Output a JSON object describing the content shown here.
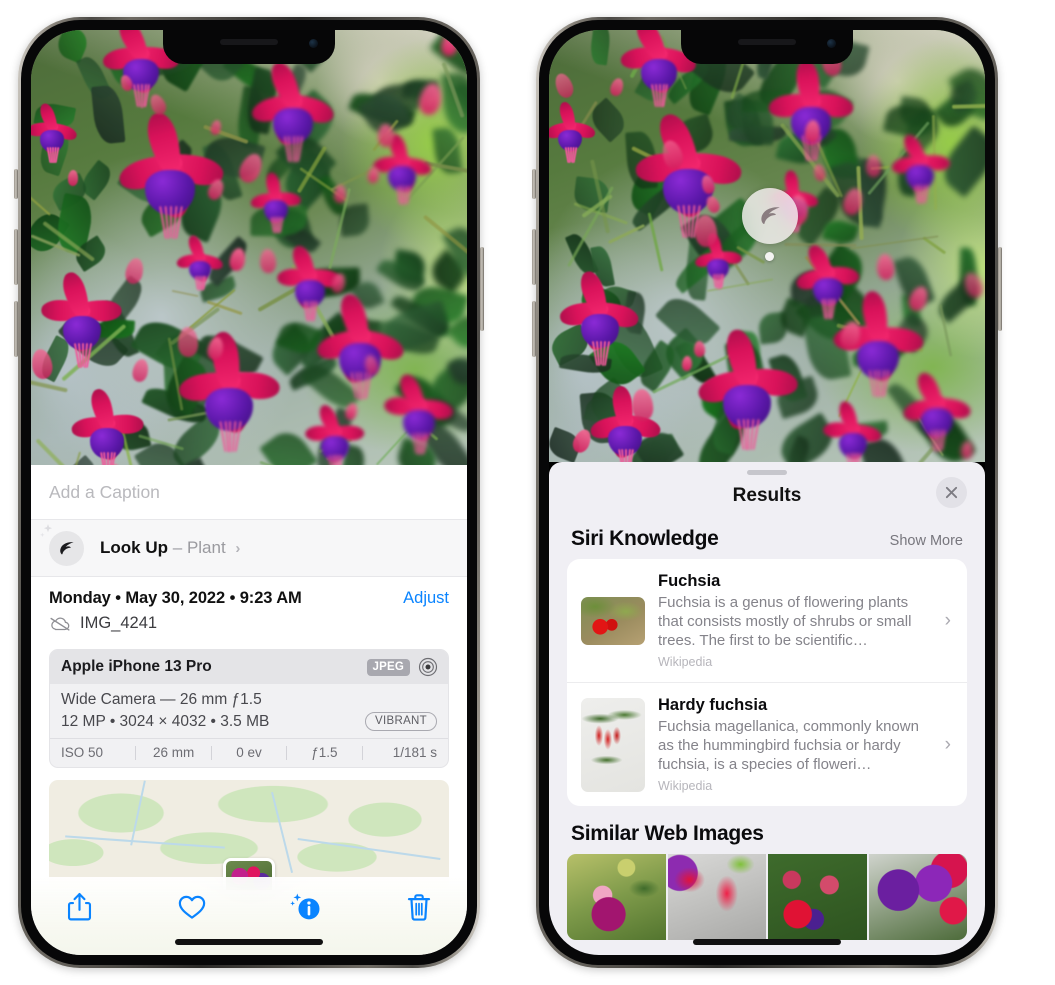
{
  "left_phone": {
    "caption_field": {
      "placeholder": "Add a Caption",
      "value": ""
    },
    "look_up": {
      "label": "Look Up",
      "dash": "–",
      "subject": "Plant",
      "chevron": "›",
      "icon": "leaf-icon"
    },
    "metadata": {
      "date_line": "Monday • May 30, 2022 • 9:23 AM",
      "adjust_label": "Adjust",
      "filename": "IMG_4241",
      "cloud_icon": "icloud-slash-icon"
    },
    "exif": {
      "device": "Apple iPhone 13 Pro",
      "format_tag": "JPEG",
      "raw_icon": "raw-target-icon",
      "lens": "Wide Camera — 26 mm ƒ1.5",
      "size": "12 MP • 3024 × 4032 • 3.5 MB",
      "style_tag": "VIBRANT",
      "stats": [
        "ISO 50",
        "26 mm",
        "0 ev",
        "ƒ1.5",
        "1/181 s"
      ]
    },
    "map": {
      "label": "photo-location-map"
    },
    "toolbar": [
      {
        "name": "share-button",
        "icon": "share-icon"
      },
      {
        "name": "favorite-button",
        "icon": "heart-icon"
      },
      {
        "name": "info-button",
        "icon": "info-sparkle-icon"
      },
      {
        "name": "delete-button",
        "icon": "trash-icon"
      }
    ]
  },
  "right_phone": {
    "badge": {
      "icon": "leaf-icon",
      "name": "visual-lookup-badge"
    },
    "sheet": {
      "title": "Results",
      "close_icon": "close-icon",
      "sections": [
        {
          "title": "Siri Knowledge",
          "action": "Show More",
          "items": [
            {
              "title": "Fuchsia",
              "description": "Fuchsia is a genus of flowering plants that consists mostly of shrubs or small trees. The first to be scientific…",
              "source": "Wikipedia",
              "chevron": "›"
            },
            {
              "title": "Hardy fuchsia",
              "description": "Fuchsia magellanica, commonly known as the hummingbird fuchsia or hardy fuchsia, is a species of floweri…",
              "source": "Wikipedia",
              "chevron": "›"
            }
          ]
        },
        {
          "title": "Similar Web Images",
          "action": "",
          "images": [
            "web-image-1",
            "web-image-2",
            "web-image-3",
            "web-image-4"
          ]
        }
      ]
    }
  },
  "colors": {
    "accent_blue": "#0a84ff",
    "sheet_bg": "#f0eff4",
    "card_bg": "#ffffff",
    "secondary_text": "#84838a",
    "tag_gray": "#a8a8af"
  }
}
